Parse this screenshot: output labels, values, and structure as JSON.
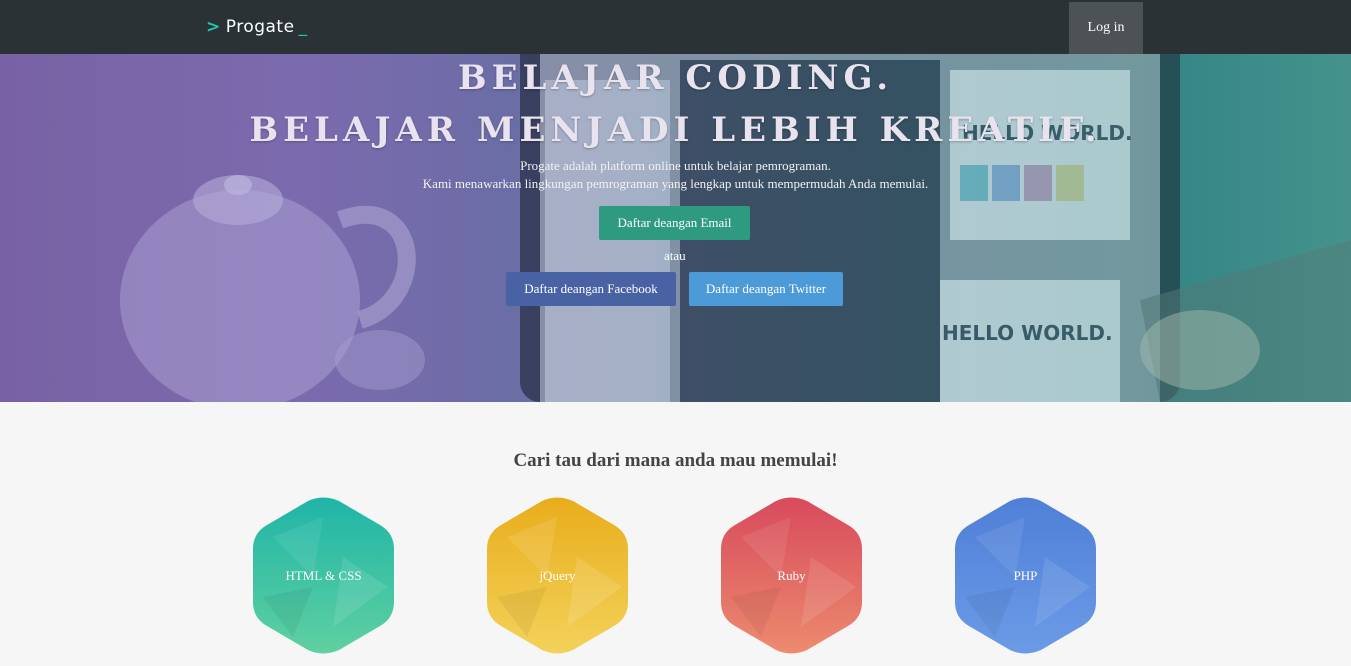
{
  "header": {
    "logo_text": "Progate",
    "logo_chevron": ">",
    "logo_cursor": "_",
    "login_label": "Log in"
  },
  "hero": {
    "title_line1": "BELAJAR CODING.",
    "title_line2": "BELAJAR MENJADI LEBIH KREATIF.",
    "subtitle_line1": "Progate adalah platform online untuk belajar pemrograman.",
    "subtitle_line2": "Kami menawarkan lingkungan pemrograman yang lengkap untuk mempermudah Anda memulai.",
    "email_button": "Daftar deangan Email",
    "or_text": "atau",
    "facebook_button": "Daftar deangan Facebook",
    "twitter_button": "Daftar deangan Twitter"
  },
  "courses": {
    "title": "Cari tau dari mana anda mau memulai!",
    "items": [
      {
        "label": "HTML & CSS",
        "color_top": "#1fb5a8",
        "color_bottom": "#5fd0a0"
      },
      {
        "label": "jQuery",
        "color_top": "#e9ad1c",
        "color_bottom": "#f3d25a"
      },
      {
        "label": "Ruby",
        "color_top": "#d84a5c",
        "color_bottom": "#ec8b6e"
      },
      {
        "label": "PHP",
        "color_top": "#4f7fd8",
        "color_bottom": "#6b9be6"
      }
    ]
  },
  "colors": {
    "header_bg": "#2a3236",
    "accent": "#22c3a6",
    "email_button": "#2e9b80",
    "facebook_button": "#4862a4",
    "twitter_button": "#4c9bd8"
  }
}
